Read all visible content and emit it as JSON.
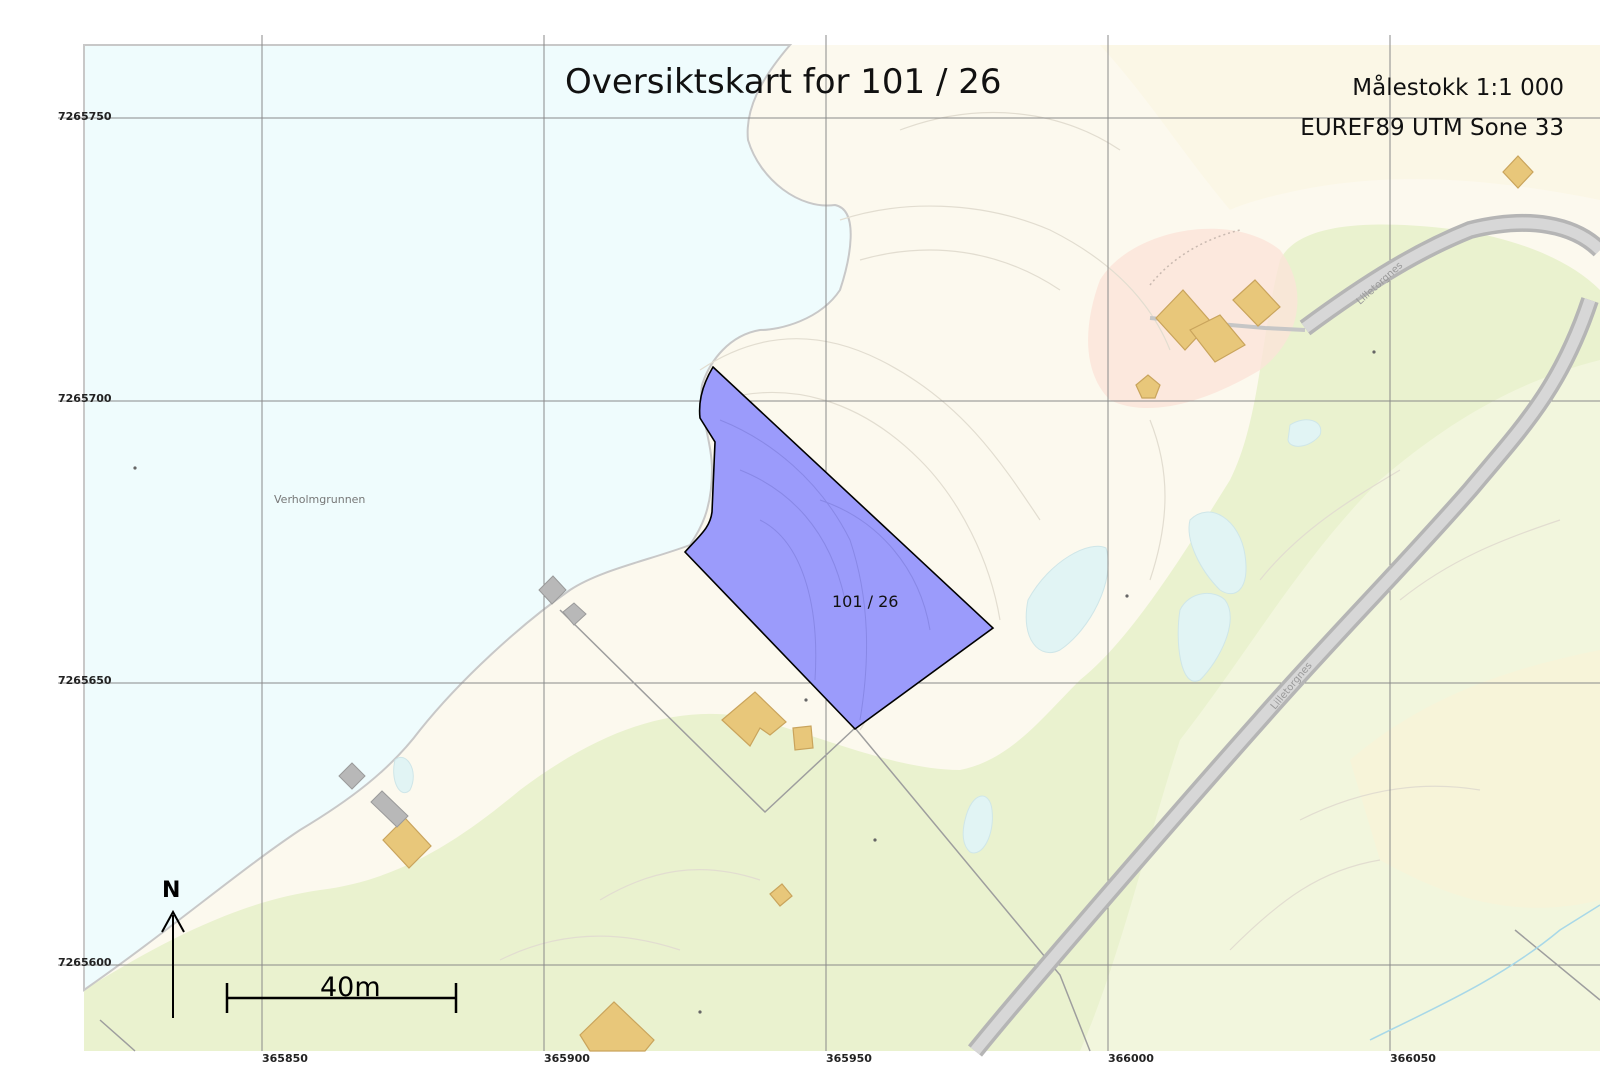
{
  "title": "Oversiktskart for 101 / 26",
  "scale": "Målestokk 1:1 000",
  "projection": "EUREF89 UTM Sone 33",
  "grid": {
    "northing_labels": [
      "7265750",
      "7265700",
      "7265650",
      "7265600"
    ],
    "easting_labels": [
      "365850",
      "365900",
      "365950",
      "366000",
      "366050"
    ]
  },
  "north_arrow": "N",
  "scalebar": "40m",
  "parcel": {
    "label": "101 / 26",
    "color": "#9b9bfb"
  },
  "place_names": [
    "Verholmgrunnen"
  ],
  "road_labels": [
    "Lilletorgnes",
    "Lilletorgnes"
  ],
  "colors": {
    "water": "#effcfd",
    "land": "#fdfaf0",
    "vegetation": "#eaf2cf",
    "building": "#e8c77a",
    "road": "#bdbdbd"
  }
}
